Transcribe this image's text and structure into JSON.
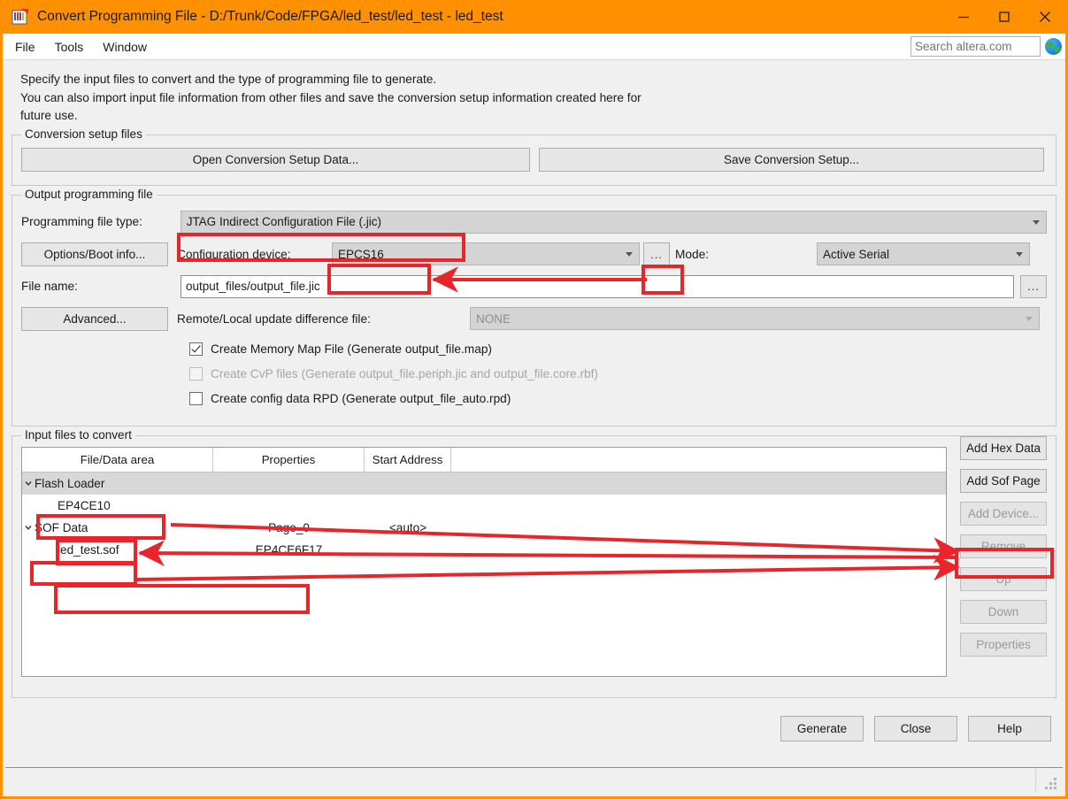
{
  "window": {
    "title": "Convert Programming File - D:/Trunk/Code/FPGA/led_test/led_test - led_test",
    "icon": "programming-file-icon",
    "minimize_icon": "minimize-icon",
    "maximize_icon": "maximize-icon",
    "close_icon": "close-icon",
    "accent_color": "#ff9100"
  },
  "menubar": {
    "items": [
      {
        "label": "File"
      },
      {
        "label": "Tools"
      },
      {
        "label": "Window"
      }
    ],
    "search": {
      "placeholder": "Search altera.com",
      "value": "",
      "icon": "globe-icon"
    }
  },
  "intro": {
    "line1": "Specify the input files to convert and the type of programming file to generate.",
    "line2": "You can also import input file information from other files and save the conversion setup information created here for",
    "line3": "future use."
  },
  "conversion_setup": {
    "legend": "Conversion setup files",
    "open_button": "Open Conversion Setup Data...",
    "save_button": "Save Conversion Setup..."
  },
  "output_programming_file": {
    "legend": "Output programming file",
    "file_type_label": "Programming file type:",
    "file_type_value": "JTAG Indirect Configuration File (.jic)",
    "options_button": "Options/Boot info...",
    "config_device_label": "Configuration device:",
    "config_device_value": "EPCS16",
    "browse_device_button": "...",
    "mode_label": "Mode:",
    "mode_value": "Active Serial",
    "file_name_label": "File name:",
    "file_name_value": "output_files/output_file.jic",
    "file_name_browse_button": "...",
    "advanced_button": "Advanced...",
    "remote_update_label": "Remote/Local update difference file:",
    "remote_update_value": "NONE",
    "checkboxes": [
      {
        "label": "Create Memory Map File (Generate output_file.map)",
        "checked": true,
        "enabled": true
      },
      {
        "label": "Create CvP files (Generate output_file.periph.jic and output_file.core.rbf)",
        "checked": false,
        "enabled": false
      },
      {
        "label": "Create config data RPD (Generate output_file_auto.rpd)",
        "checked": false,
        "enabled": true
      }
    ]
  },
  "input_files": {
    "legend": "Input files to convert",
    "columns": [
      "File/Data area",
      "Properties",
      "Start Address"
    ],
    "rows": [
      {
        "name": "Flash Loader",
        "properties": "",
        "start_address": "",
        "indent": 0,
        "expander": "chevron-down-icon",
        "selected": true
      },
      {
        "name": "EP4CE10",
        "properties": "",
        "start_address": "",
        "indent": 1,
        "expander": "",
        "selected": false
      },
      {
        "name": "SOF Data",
        "properties": "Page_0",
        "start_address": "<auto>",
        "indent": 0,
        "expander": "chevron-down-icon",
        "selected": false
      },
      {
        "name": "led_test.sof",
        "properties": "EP4CE6F17",
        "start_address": "",
        "indent": 1,
        "expander": "",
        "selected": false
      }
    ],
    "side_buttons": [
      {
        "label": "Add Hex Data",
        "enabled": true
      },
      {
        "label": "Add Sof Page",
        "enabled": true
      },
      {
        "label": "Add Device...",
        "enabled": false
      },
      {
        "label": "Remove",
        "enabled": false
      },
      {
        "label": "Up",
        "enabled": false
      },
      {
        "label": "Down",
        "enabled": false
      },
      {
        "label": "Properties",
        "enabled": false
      }
    ]
  },
  "footer": {
    "generate_button": "Generate",
    "close_button": "Close",
    "help_button": "Help"
  },
  "annotations": {
    "highlight_color": "#e8252a",
    "boxes": [
      "programming-file-type-value",
      "configuration-device-value",
      "configuration-device-browse",
      "flash-loader-row",
      "ep4ce10-row",
      "sof-data-row",
      "led-test-sof-row",
      "add-device-button"
    ],
    "arrows": [
      "add-device-to-flash-loader",
      "add-device-to-ep4ce10",
      "add-device-to-sof-data",
      "browse-to-configuration-device"
    ]
  }
}
